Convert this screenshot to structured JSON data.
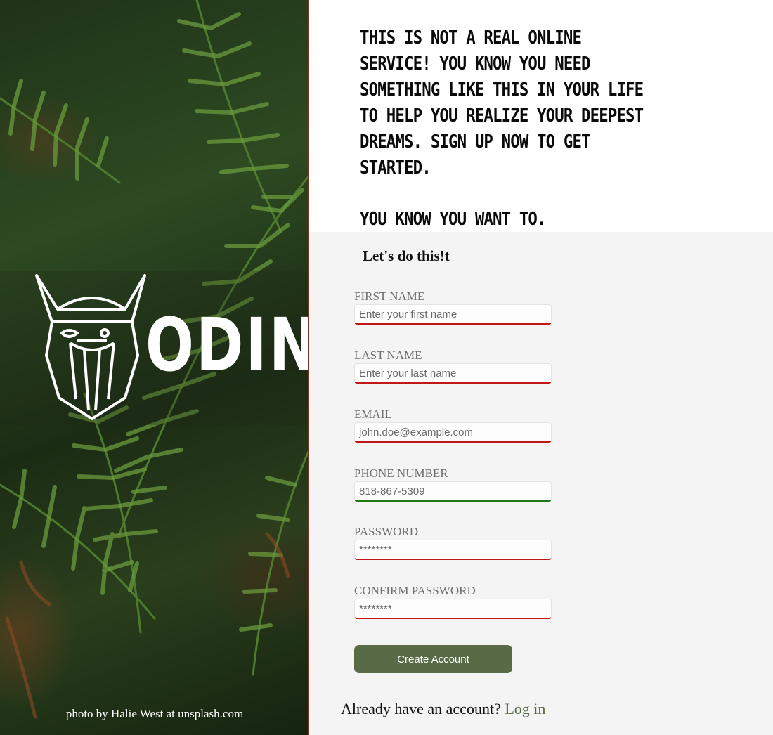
{
  "left_panel": {
    "brand": "ODIN",
    "photo_credit": "photo by Halie West at unsplash.com"
  },
  "intro": {
    "paragraph1": "THIS IS NOT A REAL ONLINE SERVICE! YOU KNOW YOU NEED SOMETHING LIKE THIS IN YOUR LIFE TO HELP YOU REALIZE YOUR DEEPEST DREAMS. SIGN UP NOW TO GET STARTED.",
    "paragraph2": "YOU KNOW YOU WANT TO."
  },
  "form": {
    "heading": "Let's do this!t",
    "fields": [
      {
        "label": "FIRST NAME",
        "placeholder": "Enter your first name",
        "value": "",
        "state": "invalid"
      },
      {
        "label": "LAST NAME",
        "placeholder": "Enter your last name",
        "value": "",
        "state": "invalid"
      },
      {
        "label": "EMAIL",
        "placeholder": "john.doe@example.com",
        "value": "",
        "state": "invalid"
      },
      {
        "label": "PHONE NUMBER",
        "placeholder": "818-867-5309",
        "value": "",
        "state": "valid"
      },
      {
        "label": "PASSWORD",
        "placeholder": "********",
        "value": "",
        "state": "invalid"
      },
      {
        "label": "CONFIRM PASSWORD",
        "placeholder": "********",
        "value": "",
        "state": "invalid"
      }
    ],
    "submit_label": "Create Account",
    "login_prompt": "Already have an account?",
    "login_link": "Log in"
  },
  "colors": {
    "button": "#596b46",
    "link": "#5a6b47",
    "invalid_border": "#c41616",
    "valid_border": "#1e7a16"
  }
}
